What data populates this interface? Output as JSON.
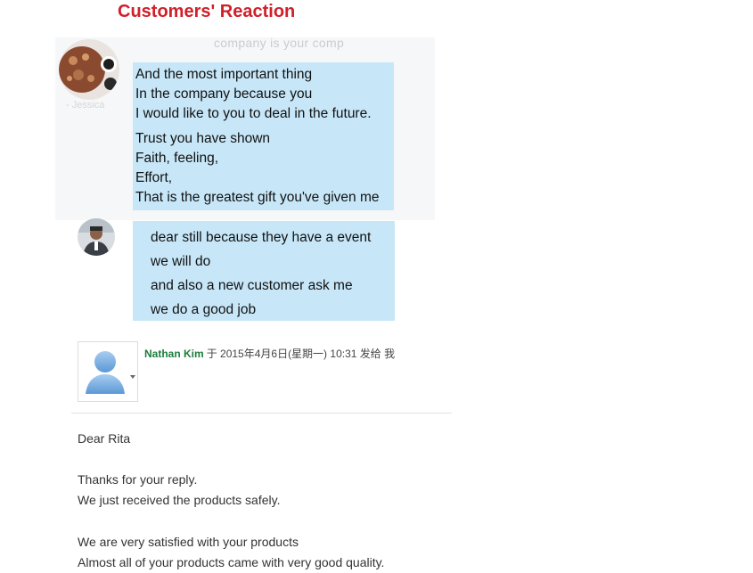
{
  "header": {
    "title": "Customers' Reaction"
  },
  "chat": {
    "faded_text": "company is your comp",
    "faded_name": "- Jessica",
    "bubble1": [
      "And the most important thing",
      " In the company because you",
      " I would like to you to deal in the future.",
      "Trust you have shown",
      " Faith, feeling,",
      " Effort,",
      " That is the greatest gift you've given me"
    ],
    "bubble2": [
      "dear still because they have a event",
      "we will do",
      "and also a new customer ask me",
      "we do a good job"
    ]
  },
  "email": {
    "sender_name": "Nathan Kim",
    "sender_meta": "于 2015年4月6日(星期一) 10:31 发给 我",
    "greeting": "Dear Rita",
    "body": [
      "Thanks for your reply.",
      "We just received the products safely.",
      "We are very satisfied with your products",
      "Almost all of your products came with very good quality."
    ]
  },
  "colors": {
    "title": "#d0202a",
    "bubble": "#c7e7f8",
    "sender": "#1c7d3c"
  },
  "icons": {
    "avatar1": "user-avatar-photo",
    "avatar2": "user-avatar-photo",
    "profile": "default-user-icon",
    "caret": "chevron-down-icon"
  }
}
